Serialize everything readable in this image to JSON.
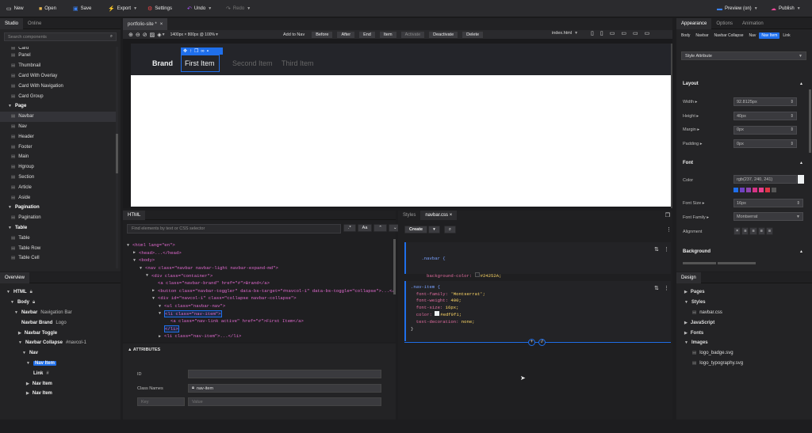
{
  "topbar": {
    "new": "New",
    "open": "Open",
    "save": "Save",
    "export": "Export",
    "settings": "Settings",
    "undo": "Undo",
    "redo": "Redo",
    "preview": "Preview (on)",
    "publish": "Publish"
  },
  "left": {
    "tabs": [
      "Studio",
      "Online"
    ],
    "search_placeholder": "Search components",
    "items": [
      {
        "label": "Card",
        "type": "item"
      },
      {
        "label": "Panel",
        "type": "item"
      },
      {
        "label": "Thumbnail",
        "type": "item"
      },
      {
        "label": "Card With Overlay",
        "type": "item"
      },
      {
        "label": "Card With Navigation",
        "type": "item"
      },
      {
        "label": "Card Group",
        "type": "item"
      },
      {
        "label": "Page",
        "type": "group"
      },
      {
        "label": "Navbar",
        "type": "item"
      },
      {
        "label": "Nav",
        "type": "item"
      },
      {
        "label": "Header",
        "type": "item"
      },
      {
        "label": "Footer",
        "type": "item"
      },
      {
        "label": "Main",
        "type": "item"
      },
      {
        "label": "Hgroup",
        "type": "item"
      },
      {
        "label": "Section",
        "type": "item"
      },
      {
        "label": "Article",
        "type": "item"
      },
      {
        "label": "Aside",
        "type": "item"
      },
      {
        "label": "Pagination",
        "type": "group"
      },
      {
        "label": "Pagination",
        "type": "item"
      },
      {
        "label": "Table",
        "type": "group"
      },
      {
        "label": "Table",
        "type": "item"
      },
      {
        "label": "Table Row",
        "type": "item"
      },
      {
        "label": "Table Cell",
        "type": "item"
      }
    ],
    "overview_title": "Overview",
    "overview": [
      {
        "label": "HTML",
        "sub": "",
        "indent": 0
      },
      {
        "label": "Body",
        "sub": "",
        "indent": 1
      },
      {
        "label": "Navbar",
        "sub": "Navigation Bar",
        "indent": 2
      },
      {
        "label": "Navbar Brand",
        "sub": "Logo",
        "indent": 3
      },
      {
        "label": "Navbar Toggle",
        "sub": "",
        "indent": 3
      },
      {
        "label": "Navbar Collapse",
        "sub": "#navcol-1",
        "indent": 3
      },
      {
        "label": "Nav",
        "sub": "",
        "indent": 4
      },
      {
        "label": "Nav Item",
        "sub": "",
        "indent": 5
      },
      {
        "label": "Link",
        "sub": "#",
        "indent": 6
      },
      {
        "label": "Nav Item",
        "sub": "",
        "indent": 5
      },
      {
        "label": "Nav Item",
        "sub": "",
        "indent": 5
      }
    ]
  },
  "canvas": {
    "tab": "portfolio-site *",
    "viewport": "1400px × 800px @ 100%",
    "buttons": [
      "Add to Nav",
      "Before",
      "After",
      "End",
      "Item",
      "Activate",
      "Deactivate",
      "Delete"
    ],
    "file": "index.html",
    "brand": "Brand",
    "nav": [
      "First Item",
      "Second Item",
      "Third Item"
    ]
  },
  "html_panel": {
    "title": "HTML",
    "find_placeholder": "Find elements by text or CSS selector",
    "case_label": "Aa",
    "lines": [
      "<html lang=\"en\">",
      "<head>...</head>",
      "<body>",
      "<nav class=\"navbar navbar-light navbar-expand-md\">",
      "<div class=\"container\">",
      "<a class=\"navbar-brand\" href=\"#\">Brand</a>",
      "<button class=\"navbar-toggler\" data-bs-target=\"#navcol-1\" data-bs-toggle=\"collapse\">...</button>",
      "<div id=\"navcol-1\" class=\"collapse navbar-collapse\">",
      "<ul class=\"navbar-nav\">",
      "<li class=\"nav-item\">",
      "<a class=\"nav-link active\" href=\"#\">First Item</a>",
      "</li>",
      "<li class=\"nav-item\">...</li>"
    ],
    "attributes_title": "ATTRIBUTES",
    "id_label": "ID",
    "class_label": "Class Names",
    "class_value": "nav-item",
    "key_placeholder": "Key",
    "value_placeholder": "Value"
  },
  "styles_panel": {
    "tabs": [
      "Styles",
      "navbar.css"
    ],
    "create": "Create",
    "rule1_selector": ".navbar {",
    "rule1_prop": "background-color:",
    "rule1_val": "#24252A;",
    "rule2_selector": ".nav-item {",
    "rule2_lines": [
      [
        "font-family:",
        "'Montserrat';"
      ],
      [
        "font-weight:",
        "400;"
      ],
      [
        "font-size:",
        "16px;"
      ],
      [
        "color:",
        "#edf0f1;"
      ],
      [
        "text-decoration:",
        "none;"
      ]
    ]
  },
  "right": {
    "tabs": [
      "Appearance",
      "Options",
      "Animation"
    ],
    "crumbs": [
      "Body",
      "Navbar",
      "Navbar Collapse",
      "Nav",
      "Nav Item",
      "Link"
    ],
    "style_attr": "Style Attribute",
    "layout_title": "Layout",
    "layout": [
      {
        "label": "Width",
        "value": "92.8125px"
      },
      {
        "label": "Height",
        "value": "40px"
      },
      {
        "label": "Margin",
        "value": "0px"
      },
      {
        "label": "Padding",
        "value": "0px"
      }
    ],
    "font_title": "Font",
    "color_label": "Color",
    "color_value": "rgb(237, 240, 241)",
    "font_size_label": "Font Size",
    "font_size_value": "16px",
    "font_family_label": "Font Family",
    "font_family_value": "Montserrat",
    "alignment_label": "Alignment",
    "background_title": "Background",
    "design_title": "Design",
    "design_tree": [
      {
        "label": "Pages",
        "kind": "folder"
      },
      {
        "label": "Styles",
        "kind": "folder-open"
      },
      {
        "label": "navbar.css",
        "kind": "file"
      },
      {
        "label": "JavaScript",
        "kind": "folder"
      },
      {
        "label": "Fonts",
        "kind": "folder"
      },
      {
        "label": "Images",
        "kind": "folder-open"
      },
      {
        "label": "logo_badge.svg",
        "kind": "file"
      },
      {
        "label": "logo_typography.svg",
        "kind": "file"
      }
    ]
  },
  "colors": {
    "accent": "#1f6feb",
    "swatches": [
      "#1f6feb",
      "#6f42c1",
      "#8e44ad",
      "#d63384",
      "#e83e8c",
      "#dc3545",
      "#555555"
    ]
  }
}
